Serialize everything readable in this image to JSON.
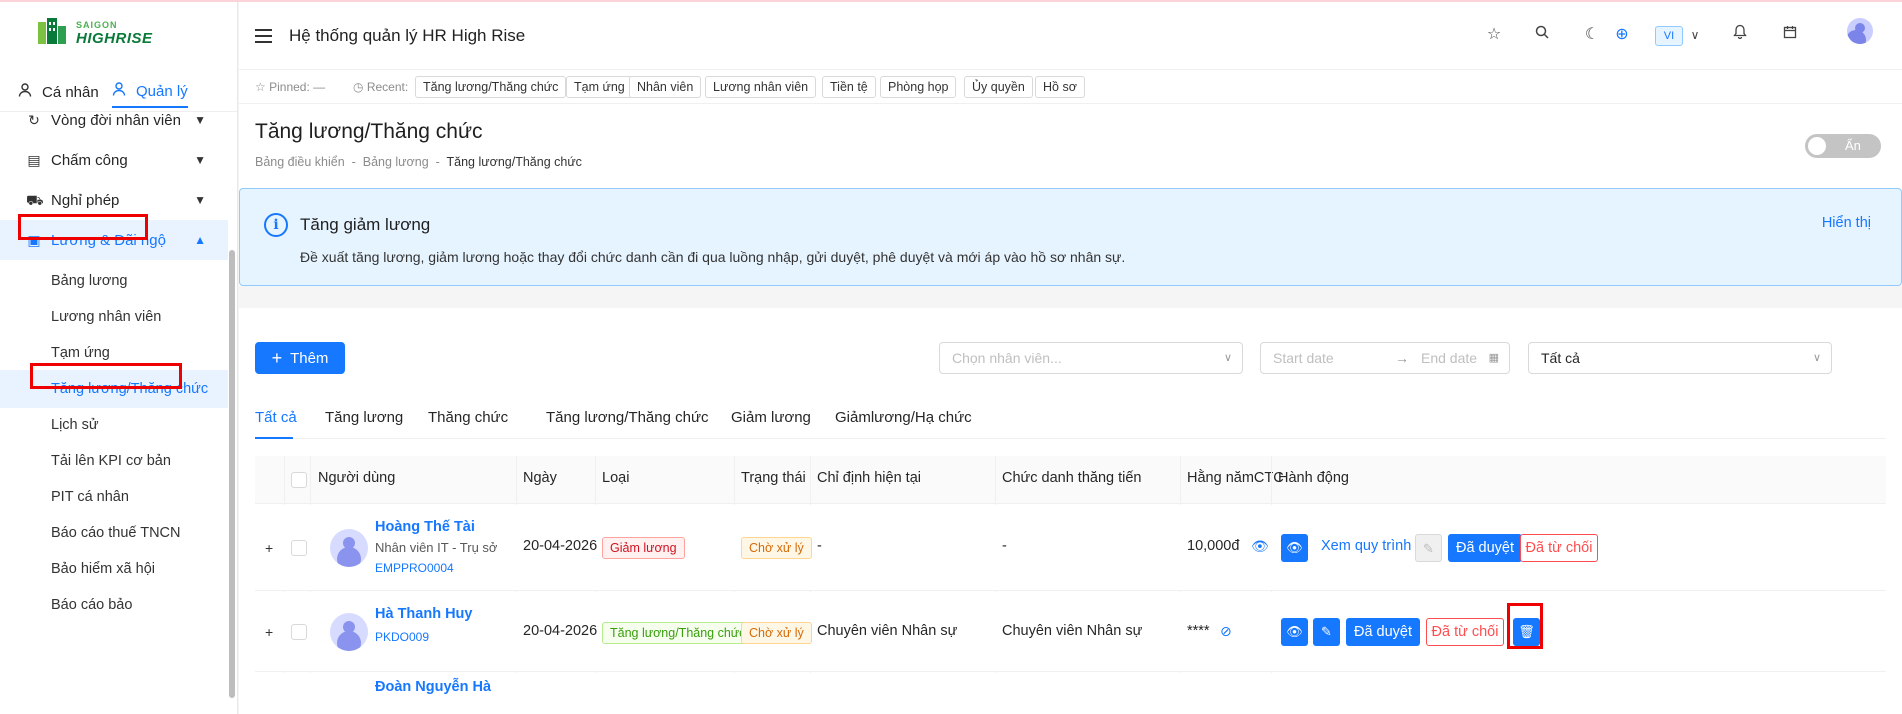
{
  "brand": {
    "logo_top": "SAIGON",
    "logo_main": "HIGHRISE"
  },
  "sidebar": {
    "tabs": [
      {
        "label": "Cá nhân"
      },
      {
        "label": "Quản lý"
      }
    ],
    "items": [
      {
        "label": "Vòng đời nhân viên"
      },
      {
        "label": "Chấm công"
      },
      {
        "label": "Nghỉ phép"
      },
      {
        "label": "Lương & Đãi ngộ"
      }
    ],
    "subitems": [
      {
        "label": "Bảng lương"
      },
      {
        "label": "Lương nhân viên"
      },
      {
        "label": "Tạm ứng"
      },
      {
        "label": "Tăng lương/Thăng chức"
      },
      {
        "label": "Lịch sử"
      },
      {
        "label": "Tải lên KPI cơ bản"
      },
      {
        "label": "PIT cá nhân"
      },
      {
        "label": "Báo cáo thuế TNCN"
      },
      {
        "label": "Bảo hiểm xã hội"
      },
      {
        "label": "Báo cáo bảo"
      }
    ]
  },
  "header": {
    "title": "Hệ thống quản lý HR High Rise",
    "lang": "VI"
  },
  "recent_bar": {
    "pinned_label": "Pinned:",
    "pinned_value": "—",
    "recent_label": "Recent:",
    "chips": [
      "Tăng lương/Thăng chức",
      "Tạm ứng",
      "Nhân viên",
      "Lương nhân viên",
      "Tiền tệ",
      "Phòng họp",
      "Ủy quyền",
      "Hồ sơ"
    ]
  },
  "page": {
    "title": "Tăng lương/Thăng chức",
    "breadcrumbs": [
      "Bảng điều khiển",
      "Bảng lương",
      "Tăng lương/Thăng chức"
    ],
    "breadcrumb_sep": "-",
    "toggle_label": "Ẩn"
  },
  "alert": {
    "title": "Tăng giảm lương",
    "description": "Đề xuất tăng lương, giảm lương hoặc thay đổi chức danh cần đi qua luồng nhập, gửi duyệt, phê duyệt và mới áp vào hồ sơ nhân sự.",
    "link": "Hiển thị"
  },
  "filters": {
    "add_label": "Thêm",
    "employee_placeholder": "Chọn nhân viên...",
    "start_placeholder": "Start date",
    "end_placeholder": "End date",
    "status_value": "Tất cả"
  },
  "tabs": [
    "Tất cả",
    "Tăng lương",
    "Thăng chức",
    "Tăng lương/Thăng chức",
    "Giảm lương",
    "Giảmlương/Hạ chức"
  ],
  "table": {
    "columns": [
      "Người dùng",
      "Ngày",
      "Loại",
      "Trạng thái",
      "Chỉ định hiện tại",
      "Chức danh thăng tiến",
      "Hằng nămCTC",
      "Hành động"
    ],
    "rows": [
      {
        "name": "Hoàng Thế Tài",
        "subtitle": "Nhân viên IT - Trụ sở",
        "code": "EMPPRO0004",
        "date": "20-04-2026",
        "type": "Giảm lương",
        "status": "Chờ xử lý",
        "current": "-",
        "promoted": "-",
        "ctc": "10,000đ",
        "process_link": "Xem quy trình",
        "approve": "Đã duyệt",
        "reject": "Đã từ chối"
      },
      {
        "name": "Hà Thanh Huy",
        "subtitle": "",
        "code": "PKDO009",
        "date": "20-04-2026",
        "type": "Tăng lương/Thăng chức",
        "status": "Chờ xử lý",
        "current": "Chuyên viên Nhân sự",
        "promoted": "Chuyên viên Nhân sự",
        "ctc": "****",
        "approve": "Đã duyệt",
        "reject": "Đã từ chối"
      },
      {
        "name": "Đoàn Nguyễn Hà"
      }
    ]
  },
  "colors": {
    "accent": "#1677ff",
    "highlight": "#ee0000"
  }
}
